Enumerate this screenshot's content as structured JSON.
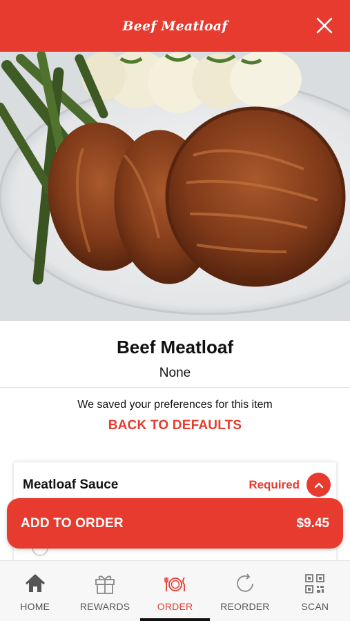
{
  "header": {
    "title": "Beef Meatloaf"
  },
  "item": {
    "name": "Beef Meatloaf",
    "subtitle": "None",
    "saved_message": "We saved your preferences for this item",
    "defaults_link": "BACK TO DEFAULTS"
  },
  "modifier": {
    "title": "Meatloaf Sauce",
    "status": "Required"
  },
  "cart": {
    "add_label": "ADD TO ORDER",
    "price": "$9.45"
  },
  "tabs": [
    {
      "label": "HOME",
      "icon": "home-icon"
    },
    {
      "label": "REWARDS",
      "icon": "gift-icon"
    },
    {
      "label": "ORDER",
      "icon": "plate-utensils-icon",
      "active": true
    },
    {
      "label": "REORDER",
      "icon": "refresh-icon"
    },
    {
      "label": "SCAN",
      "icon": "qr-code-icon"
    }
  ],
  "colors": {
    "brand_red": "#e63b2e",
    "tab_inactive": "#555555"
  }
}
